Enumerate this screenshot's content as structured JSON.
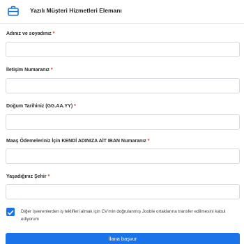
{
  "header": {
    "title": "Yazılı Müşteri Hizmetleri Elemanı",
    "icon": "briefcase-icon",
    "accent_color": "#1a73e8"
  },
  "form": {
    "required_marker": "*",
    "fields": [
      {
        "label": "Adınız ve soyadınız",
        "value": "",
        "placeholder": ""
      },
      {
        "label": "İletişim Numaranız",
        "value": "",
        "placeholder": ""
      },
      {
        "label": "Doğum Tarihiniz (GG.AA.YY)",
        "value": "",
        "placeholder": ""
      },
      {
        "label": "Maaş Ödemeleriniz İçin KENDİ ADINIZA AİT IBAN Numaranız",
        "value": "",
        "placeholder": ""
      },
      {
        "label": "Yaşadığınız Şehir",
        "value": "",
        "placeholder": ""
      }
    ],
    "consent": {
      "checked": true,
      "text": "Diğer işverenlerden iş teklifleri almak için CV'min doğrulanmış Jooble ortaklarına transfer edilmesini kabul ediyorum",
      "icon": "check-icon"
    },
    "submit_label": "İlana başvur"
  }
}
